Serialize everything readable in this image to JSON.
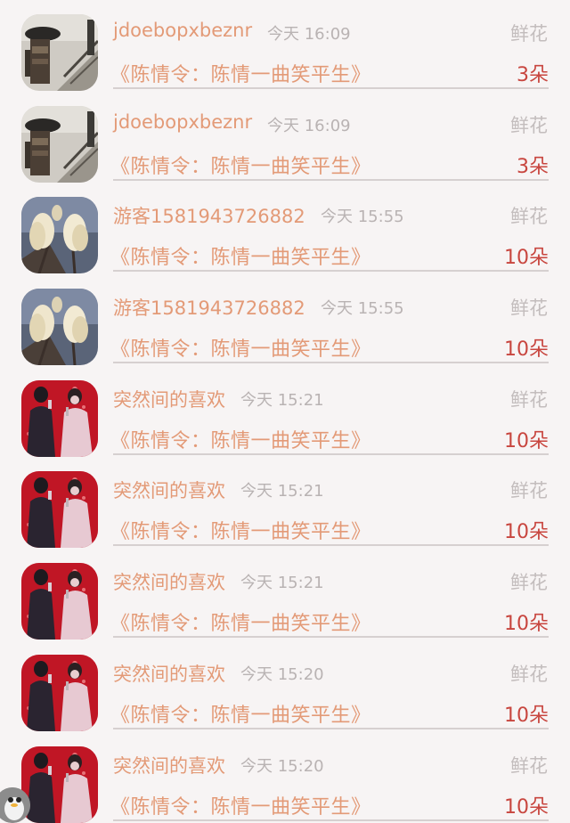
{
  "records": [
    {
      "name": "jdoebopxbeznr",
      "time": "今天 16:09",
      "type": "鲜花",
      "title": "《陈情令：陈情一曲笑平生》",
      "count": "3朵",
      "avatar": "rainy-street-photo"
    },
    {
      "name": "jdoebopxbeznr",
      "time": "今天 16:09",
      "type": "鲜花",
      "title": "《陈情令：陈情一曲笑平生》",
      "count": "3朵",
      "avatar": "rainy-street-photo"
    },
    {
      "name": "游客1581943726882",
      "time": "今天 15:55",
      "type": "鲜花",
      "title": "《陈情令：陈情一曲笑平生》",
      "count": "10朵",
      "avatar": "white-magnolia-photo"
    },
    {
      "name": "游客1581943726882",
      "time": "今天 15:55",
      "type": "鲜花",
      "title": "《陈情令：陈情一曲笑平生》",
      "count": "10朵",
      "avatar": "white-magnolia-photo"
    },
    {
      "name": "突然间的喜欢",
      "time": "今天 15:21",
      "type": "鲜花",
      "title": "《陈情令：陈情一曲笑平生》",
      "count": "10朵",
      "avatar": "stage-singers-photo"
    },
    {
      "name": "突然间的喜欢",
      "time": "今天 15:21",
      "type": "鲜花",
      "title": "《陈情令：陈情一曲笑平生》",
      "count": "10朵",
      "avatar": "stage-singers-photo"
    },
    {
      "name": "突然间的喜欢",
      "time": "今天 15:21",
      "type": "鲜花",
      "title": "《陈情令：陈情一曲笑平生》",
      "count": "10朵",
      "avatar": "stage-singers-photo"
    },
    {
      "name": "突然间的喜欢",
      "time": "今天 15:20",
      "type": "鲜花",
      "title": "《陈情令：陈情一曲笑平生》",
      "count": "10朵",
      "avatar": "stage-singers-photo"
    },
    {
      "name": "突然间的喜欢",
      "time": "今天 15:20",
      "type": "鲜花",
      "title": "《陈情令：陈情一曲笑平生》",
      "count": "10朵",
      "avatar": "stage-singers-photo"
    }
  ],
  "colors": {
    "name": "#e39a77",
    "title": "#e39a77",
    "count": "#c8463f",
    "meta": "#b9b3b3",
    "background": "#f7f4f4"
  },
  "floating_icon": "penguin-icon"
}
